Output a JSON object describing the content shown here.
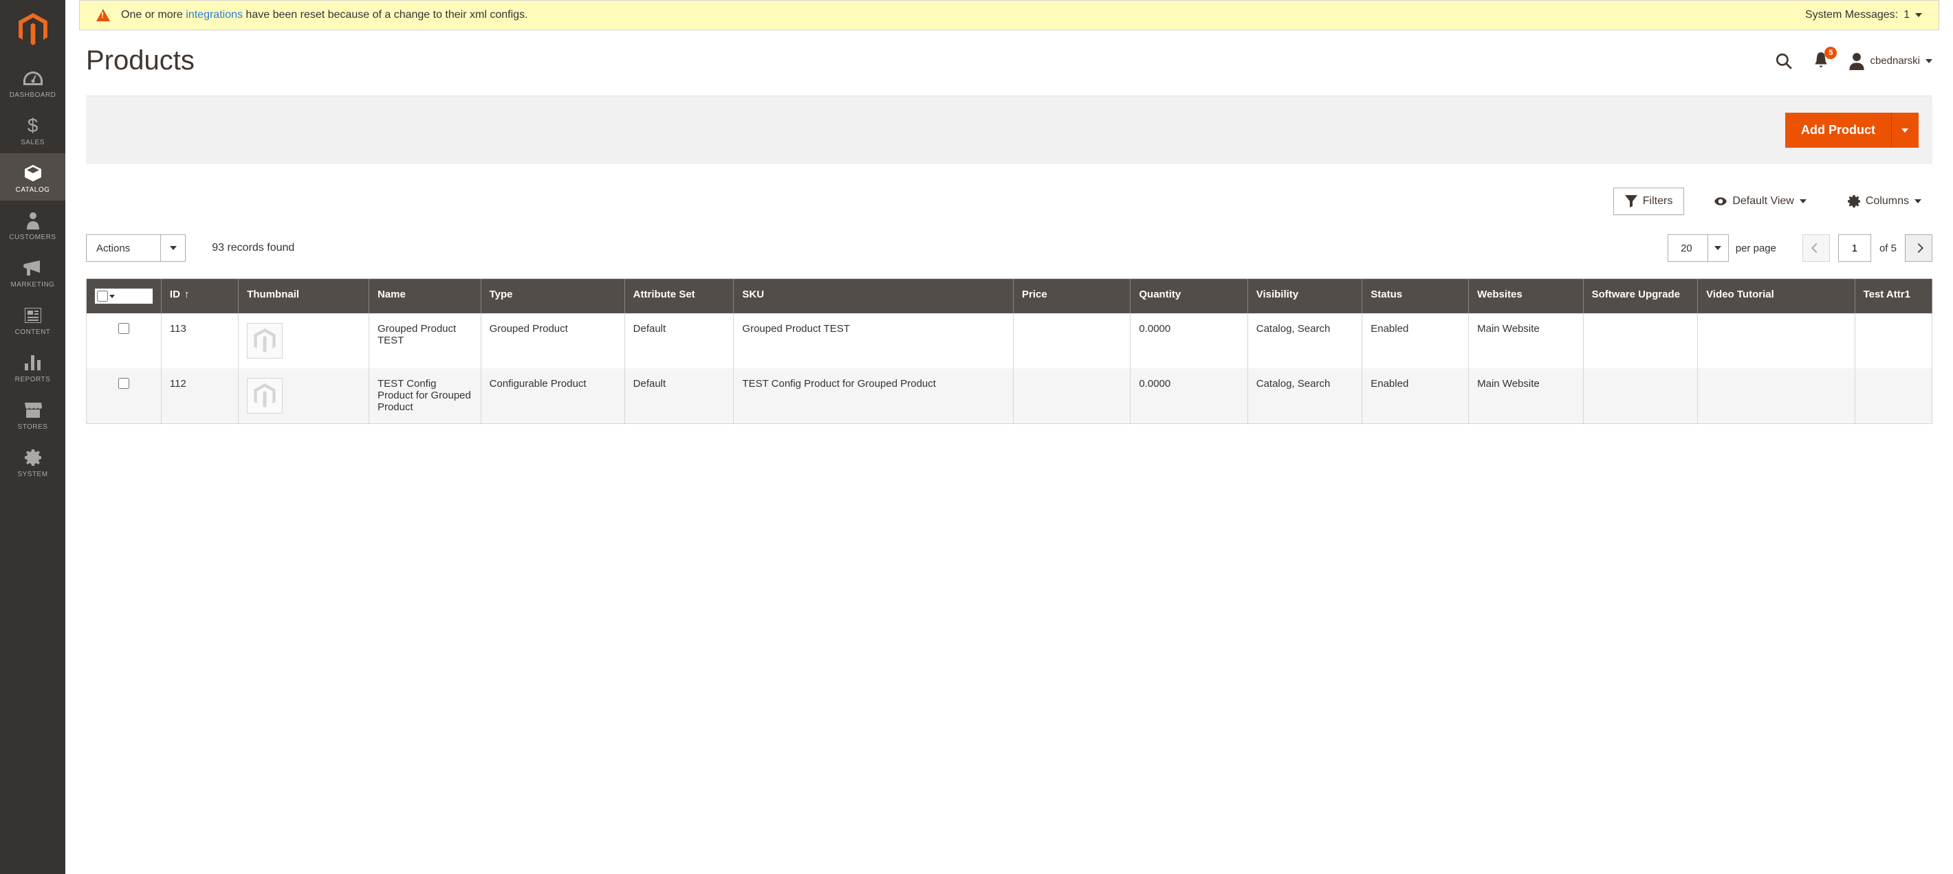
{
  "sidebar": {
    "items": [
      {
        "label": "DASHBOARD",
        "name": "sidebar-item-dashboard"
      },
      {
        "label": "SALES",
        "name": "sidebar-item-sales"
      },
      {
        "label": "CATALOG",
        "name": "sidebar-item-catalog"
      },
      {
        "label": "CUSTOMERS",
        "name": "sidebar-item-customers"
      },
      {
        "label": "MARKETING",
        "name": "sidebar-item-marketing"
      },
      {
        "label": "CONTENT",
        "name": "sidebar-item-content"
      },
      {
        "label": "REPORTS",
        "name": "sidebar-item-reports"
      },
      {
        "label": "STORES",
        "name": "sidebar-item-stores"
      },
      {
        "label": "SYSTEM",
        "name": "sidebar-item-system"
      }
    ]
  },
  "banner": {
    "text_before": "One or more ",
    "link": "integrations",
    "text_after": " have been reset because of a change to their xml configs.",
    "sys_label": "System Messages:",
    "sys_count": "1"
  },
  "header": {
    "title": "Products",
    "notif_count": "5",
    "username": "cbednarski"
  },
  "actions": {
    "add_product": "Add Product"
  },
  "toolbar": {
    "filters": "Filters",
    "default_view": "Default View",
    "columns": "Columns"
  },
  "grid_controls": {
    "actions_label": "Actions",
    "records_found": "93 records found",
    "per_page_value": "20",
    "per_page_label": "per page",
    "page_value": "1",
    "of_label": "of 5"
  },
  "table": {
    "headers": {
      "id": "ID",
      "thumbnail": "Thumbnail",
      "name": "Name",
      "type": "Type",
      "attribute_set": "Attribute Set",
      "sku": "SKU",
      "price": "Price",
      "quantity": "Quantity",
      "visibility": "Visibility",
      "status": "Status",
      "websites": "Websites",
      "software_upgrade": "Software Upgrade",
      "video_tutorial": "Video Tutorial",
      "test_attr1": "Test Attr1"
    },
    "rows": [
      {
        "id": "113",
        "name": "Grouped Product TEST",
        "type": "Grouped Product",
        "attribute_set": "Default",
        "sku": "Grouped Product TEST",
        "price": "",
        "quantity": "0.0000",
        "visibility": "Catalog, Search",
        "status": "Enabled",
        "websites": "Main Website",
        "software_upgrade": "",
        "video_tutorial": "",
        "test_attr1": ""
      },
      {
        "id": "112",
        "name": "TEST Config Product for Grouped Product",
        "type": "Configurable Product",
        "attribute_set": "Default",
        "sku": "TEST Config Product for Grouped Product",
        "price": "",
        "quantity": "0.0000",
        "visibility": "Catalog, Search",
        "status": "Enabled",
        "websites": "Main Website",
        "software_upgrade": "",
        "video_tutorial": "",
        "test_attr1": ""
      }
    ]
  }
}
